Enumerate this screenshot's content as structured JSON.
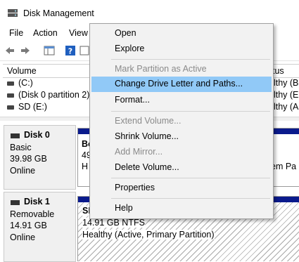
{
  "window": {
    "title": "Disk Management"
  },
  "menubar": {
    "items": [
      "File",
      "Action",
      "View"
    ]
  },
  "volume_list": {
    "header": {
      "volume": "Volume",
      "status": "tus"
    },
    "rows": [
      {
        "name": "(C:)",
        "status": "althy (B"
      },
      {
        "name": "(Disk 0 partition 2)",
        "status": "althy (E"
      },
      {
        "name": "SD (E:)",
        "status": "althy (A"
      }
    ]
  },
  "disks": [
    {
      "name": "Disk 0",
      "type": "Basic",
      "size": "39.98 GB",
      "state": "Online",
      "partition_a": {
        "line1": "Bo",
        "line2": "49",
        "line3": "H"
      },
      "partition_b": {
        "line3": "em Pa"
      }
    },
    {
      "name": "Disk 1",
      "type": "Removable",
      "size": "14.91 GB",
      "state": "Online",
      "partition": {
        "title": "SD (E:)",
        "size": "14.91 GB NTFS",
        "status": "Healthy (Active, Primary Partition)"
      }
    }
  ],
  "context_menu": {
    "items": [
      {
        "label": "Open",
        "enabled": true
      },
      {
        "label": "Explore",
        "enabled": true
      },
      {
        "label": "Mark Partition as Active",
        "enabled": false
      },
      {
        "label": "Change Drive Letter and Paths...",
        "enabled": true,
        "highlighted": true
      },
      {
        "label": "Format...",
        "enabled": true
      },
      {
        "label": "Extend Volume...",
        "enabled": false
      },
      {
        "label": "Shrink Volume...",
        "enabled": true
      },
      {
        "label": "Add Mirror...",
        "enabled": false
      },
      {
        "label": "Delete Volume...",
        "enabled": true
      },
      {
        "label": "Properties",
        "enabled": true
      },
      {
        "label": "Help",
        "enabled": true
      }
    ]
  },
  "colors": {
    "partition_bar": "#0a1a8c",
    "menu_highlight": "#91c9f7"
  }
}
